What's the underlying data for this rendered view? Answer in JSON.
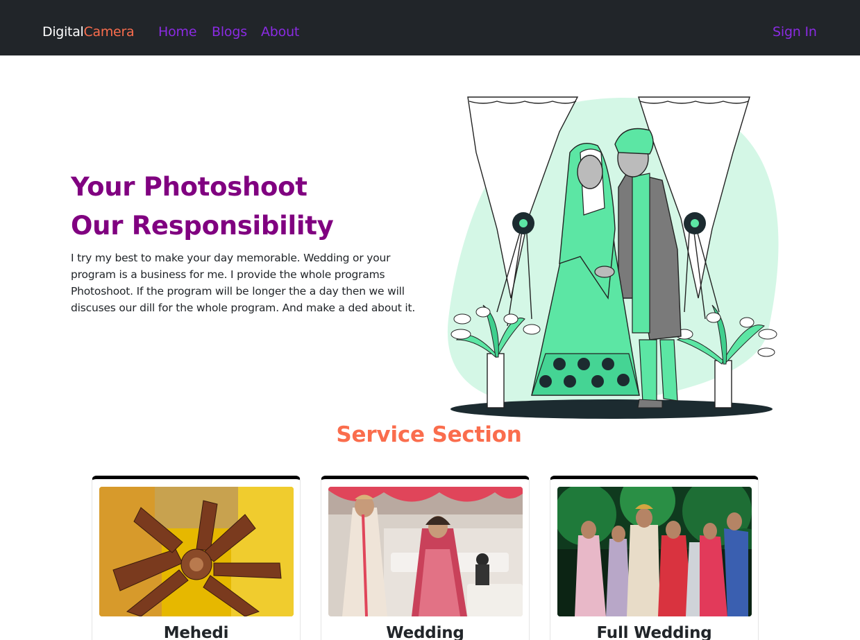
{
  "navbar": {
    "brand_part1": "Digital",
    "brand_part2": "Camera",
    "links": [
      {
        "label": "Home"
      },
      {
        "label": "Blogs"
      },
      {
        "label": "About"
      }
    ],
    "sign_in": "Sign In"
  },
  "hero": {
    "title_line1": "Your Photoshoot",
    "title_line2": "Our Responsibility",
    "description": "I try my best to make your day memorable. Wedding or your program is a business for me. I provide the whole programs Photoshoot. If the program will be longer the a day then we will discuses our dill for the whole program. And make a ded about it."
  },
  "services": {
    "title": "Service Section",
    "cards": [
      {
        "title": "Mehedi"
      },
      {
        "title": "Wedding"
      },
      {
        "title": "Full Wedding"
      }
    ]
  },
  "colors": {
    "navbar_bg": "#212529",
    "brand_accent": "#fa6d4d",
    "link": "#8a2be2",
    "hero_title": "#800080",
    "section_title": "#fa6d4d",
    "illustration_mint": "#5ce6a4"
  }
}
